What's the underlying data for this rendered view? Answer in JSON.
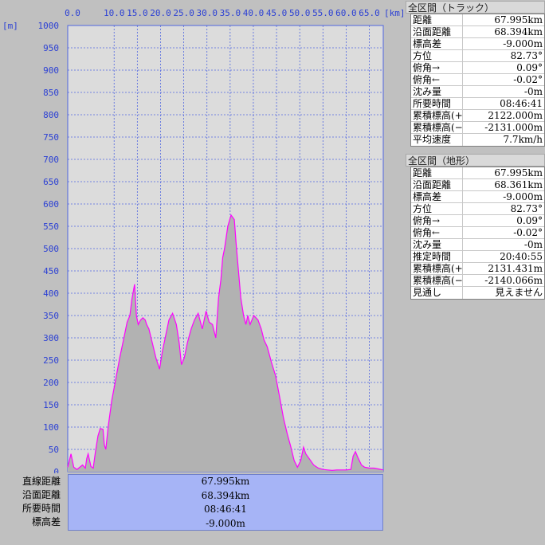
{
  "chart_data": {
    "type": "area",
    "x_unit": "[km]",
    "y_unit": "[m]",
    "xlim": [
      0,
      67.995
    ],
    "ylim": [
      0,
      1000
    ],
    "xticks": [
      "0.0",
      "10.0",
      "15.0",
      "20.0",
      "25.0",
      "30.0",
      "35.0",
      "40.0",
      "45.0",
      "50.0",
      "55.0",
      "60.0",
      "65.0"
    ],
    "xtick_values": [
      0,
      10,
      15,
      20,
      25,
      30,
      35,
      40,
      45,
      50,
      55,
      60,
      65
    ],
    "yticks": [
      "0",
      "50",
      "100",
      "150",
      "200",
      "250",
      "300",
      "350",
      "400",
      "450",
      "500",
      "550",
      "600",
      "650",
      "700",
      "750",
      "800",
      "850",
      "900",
      "950",
      "1000"
    ],
    "ytick_values": [
      0,
      50,
      100,
      150,
      200,
      250,
      300,
      350,
      400,
      450,
      500,
      550,
      600,
      650,
      700,
      750,
      800,
      850,
      900,
      950,
      1000
    ],
    "grid": true,
    "colors": {
      "line": "#ff00ff",
      "fill": "#b2b2b2",
      "grid": "#5066e0",
      "plot_bg": "#dcdcdc"
    },
    "x": [
      0,
      0.7,
      1.3,
      2.0,
      2.6,
      3.2,
      3.8,
      4.1,
      4.4,
      5.0,
      5.5,
      5.9,
      6.5,
      7.0,
      7.6,
      7.9,
      8.2,
      8.7,
      9.5,
      10.3,
      11.2,
      12.1,
      12.8,
      13.4,
      13.8,
      14.4,
      14.8,
      15.2,
      15.7,
      16.2,
      16.7,
      17.0,
      17.5,
      18.2,
      19.0,
      19.8,
      20.4,
      21.0,
      21.8,
      22.6,
      23.4,
      24.0,
      24.5,
      25.1,
      25.8,
      26.6,
      27.3,
      28.1,
      29.0,
      29.8,
      30.5,
      31.2,
      31.9,
      32.5,
      33.0,
      33.4,
      33.8,
      34.5,
      35.2,
      35.9,
      36.3,
      36.8,
      37.3,
      37.9,
      38.4,
      38.8,
      39.3,
      40.1,
      41.0,
      41.7,
      42.3,
      43.0,
      43.9,
      44.8,
      45.7,
      46.5,
      47.3,
      48.1,
      48.8,
      49.5,
      50.2,
      50.8,
      51.3,
      52.0,
      53.0,
      54.0,
      55.0,
      56.0,
      57.0,
      58.0,
      59.0,
      60.0,
      61.0,
      61.5,
      62.0,
      62.6,
      63.3,
      64.0,
      65.0,
      66.0,
      67.0,
      67.995
    ],
    "y": [
      10,
      40,
      10,
      5,
      10,
      15,
      8,
      30,
      40,
      12,
      8,
      40,
      80,
      97,
      95,
      60,
      50,
      100,
      160,
      205,
      255,
      300,
      335,
      350,
      385,
      420,
      350,
      330,
      340,
      345,
      340,
      330,
      320,
      290,
      255,
      230,
      270,
      300,
      340,
      355,
      330,
      290,
      240,
      255,
      290,
      320,
      340,
      355,
      320,
      360,
      335,
      330,
      300,
      390,
      430,
      480,
      500,
      550,
      575,
      565,
      510,
      450,
      390,
      350,
      330,
      350,
      330,
      350,
      340,
      320,
      295,
      280,
      245,
      215,
      165,
      120,
      85,
      55,
      25,
      10,
      25,
      55,
      40,
      30,
      15,
      8,
      5,
      4,
      3,
      4,
      4,
      4,
      5,
      35,
      45,
      30,
      15,
      10,
      8,
      8,
      6,
      4
    ]
  },
  "summary": {
    "labels": [
      "直線距離",
      "沿面距離",
      "所要時間",
      "標高差"
    ],
    "values": [
      "67.995km",
      "68.394km",
      "08:46:41",
      "-9.000m"
    ]
  },
  "track_panel": {
    "title": "全区間（トラック）",
    "rows": [
      {
        "k": "距離",
        "v": "67.995km"
      },
      {
        "k": "沿面距離",
        "v": "68.394km"
      },
      {
        "k": "標高差",
        "v": "-9.000m"
      },
      {
        "k": "方位",
        "v": "82.73°"
      },
      {
        "k": "俯角→",
        "v": "0.09°"
      },
      {
        "k": "俯角←",
        "v": "-0.02°"
      },
      {
        "k": "沈み量",
        "v": "-0m"
      },
      {
        "k": "所要時間",
        "v": "08:46:41"
      },
      {
        "k": "累積標高(+)",
        "v": "2122.000m"
      },
      {
        "k": "累積標高(−)",
        "v": "-2131.000m"
      },
      {
        "k": "平均速度",
        "v": "7.7km/h"
      }
    ]
  },
  "terrain_panel": {
    "title": "全区間（地形）",
    "rows": [
      {
        "k": "距離",
        "v": "67.995km"
      },
      {
        "k": "沿面距離",
        "v": "68.361km"
      },
      {
        "k": "標高差",
        "v": "-9.000m"
      },
      {
        "k": "方位",
        "v": "82.73°"
      },
      {
        "k": "俯角→",
        "v": "0.09°"
      },
      {
        "k": "俯角←",
        "v": "-0.02°"
      },
      {
        "k": "沈み量",
        "v": "-0m"
      },
      {
        "k": "推定時間",
        "v": "20:40:55"
      },
      {
        "k": "累積標高(+)",
        "v": "2131.431m"
      },
      {
        "k": "累積標高(−)",
        "v": "-2140.066m"
      },
      {
        "k": "見通し",
        "v": "見えません"
      }
    ]
  }
}
